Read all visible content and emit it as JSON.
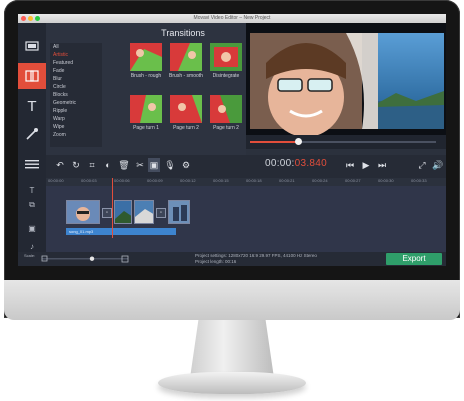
{
  "window": {
    "title": "Movavi Video Editor – New Project"
  },
  "transitions": {
    "title": "Transitions",
    "categories": [
      "All",
      "Artistic",
      "Featured",
      "Fade",
      "Blur",
      "Circle",
      "Blocks",
      "Geometric",
      "Ripple",
      "Warp",
      "Wipe",
      "Zoom"
    ],
    "selected_category": "Artistic",
    "items": [
      {
        "label": "Brush - rough"
      },
      {
        "label": "Brush - smooth"
      },
      {
        "label": "Disintegrate"
      },
      {
        "label": "Page turn 1"
      },
      {
        "label": "Page turn 2"
      },
      {
        "label": "Page turn 2"
      }
    ]
  },
  "player": {
    "timecode_main": "00:00:",
    "timecode_accent": "03.840",
    "progress_fraction": 0.26
  },
  "timeline": {
    "ruler": [
      "00:00:00",
      "00:00:03",
      "00:00:06",
      "00:00:09",
      "00:00:12",
      "00:00:15",
      "00:00:18",
      "00:00:21",
      "00:00:24",
      "00:00:27",
      "00:00:30",
      "00:00:33"
    ],
    "audio_clip_label": "song_01.mp3"
  },
  "status": {
    "scale_label": "Scale:",
    "project_settings": "Project settings:  1280x720 16:9 29.97 FPS, 44100 Hz Stereo",
    "project_length": "Project length:     00:16"
  },
  "export": {
    "label": "Export"
  },
  "colors": {
    "accent": "#e24e3b",
    "export": "#2f9e6a",
    "audio": "#3d84cf"
  }
}
